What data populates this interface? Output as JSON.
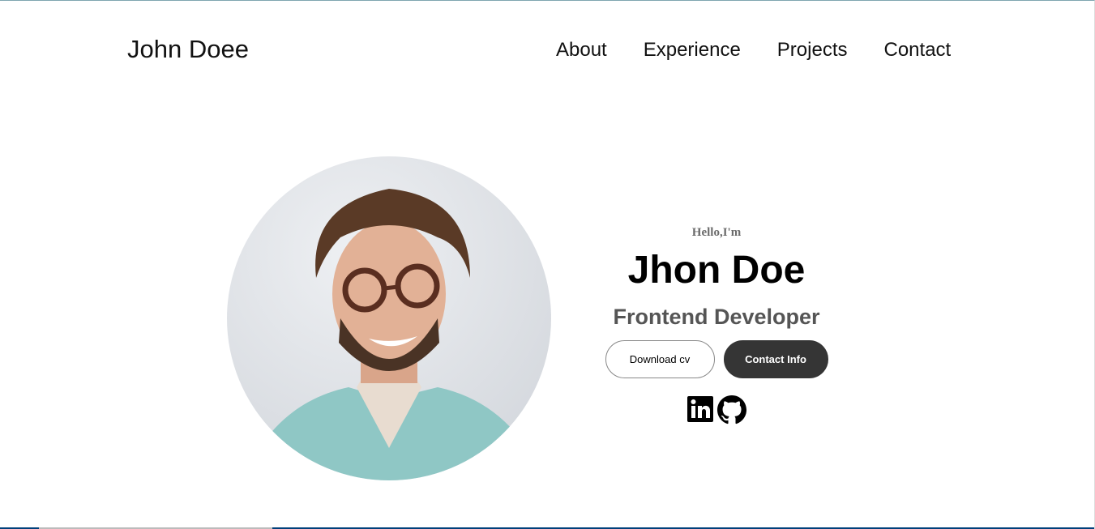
{
  "header": {
    "logo": "John Doee",
    "nav": [
      "About",
      "Experience",
      "Projects",
      "Contact"
    ]
  },
  "hero": {
    "greeting": "Hello,I'm",
    "name": "Jhon Doe",
    "role": "Frontend Developer",
    "buttons": {
      "download": "Download cv",
      "contact": "Contact Info"
    },
    "socials": [
      "linkedin-icon",
      "github-icon"
    ]
  }
}
